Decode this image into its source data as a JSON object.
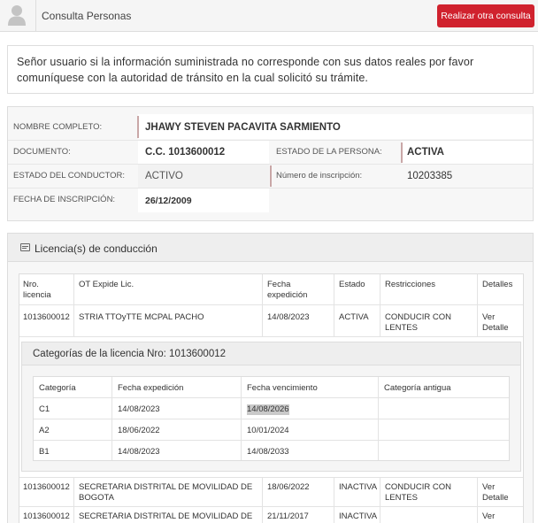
{
  "topbar": {
    "title": "Consulta Personas",
    "action_label": "Realizar otra consulta"
  },
  "notice": {
    "text": "Señor usuario si la información suministrada no corresponde con sus datos reales por favor comuníquese con la autoridad de tránsito en la cual solicitó su trámite."
  },
  "person": {
    "name_label": "NOMBRE COMPLETO:",
    "name": "JHAWY STEVEN PACAVITA SARMIENTO",
    "doc_label": "DOCUMENTO:",
    "doc": "C.C. 1013600012",
    "state_label": "ESTADO DE LA PERSONA:",
    "state": "ACTIVA",
    "driver_label": "ESTADO DEL CONDUCTOR:",
    "driver": "ACTIVO",
    "insc_label": "Número de inscripción:",
    "insc": "10203385",
    "date_label": "FECHA DE INSCRIPCIÓN:",
    "date": "26/12/2009"
  },
  "licenses": {
    "title": "Licencia(s) de conducción",
    "headers": [
      "Nro. licencia",
      "OT Expide Lic.",
      "Fecha expedición",
      "Estado",
      "Restricciones",
      "Detalles"
    ],
    "rows": [
      [
        "1013600012",
        "STRIA TTOyTTE MCPAL PACHO",
        "14/08/2023",
        "ACTIVA",
        "CONDUCIR CON LENTES",
        "Ver Detalle"
      ],
      [
        "1013600012",
        "SECRETARIA DISTRITAL DE MOVILIDAD DE BOGOTA",
        "18/06/2022",
        "INACTIVA",
        "CONDUCIR CON LENTES",
        "Ver Detalle"
      ],
      [
        "1013600012",
        "SECRETARIA DISTRITAL DE MOVILIDAD DE",
        "21/11/2017",
        "INACTIVA",
        "",
        "Ver"
      ]
    ],
    "categories": {
      "title": "Categorías de la licencia Nro: 1013600012",
      "headers": [
        "Categoría",
        "Fecha expedición",
        "Fecha vencimiento",
        "Categoría antigua"
      ],
      "rows": [
        [
          "C1",
          "14/08/2023",
          "14/08/2026",
          ""
        ],
        [
          "A2",
          "18/06/2022",
          "10/01/2024",
          ""
        ],
        [
          "B1",
          "14/08/2023",
          "14/08/2033",
          ""
        ]
      ]
    }
  }
}
